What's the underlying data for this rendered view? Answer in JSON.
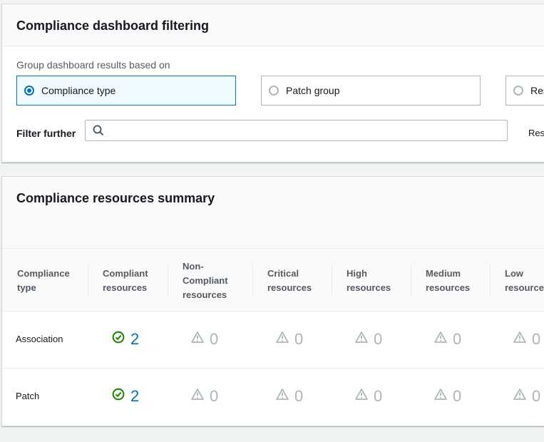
{
  "filtering": {
    "title": "Compliance dashboard filtering",
    "group_label": "Group dashboard results based on",
    "options": [
      {
        "label": "Compliance type",
        "selected": true
      },
      {
        "label": "Patch group",
        "selected": false
      },
      {
        "label": "Res",
        "selected": false
      }
    ],
    "filter_label": "Filter further",
    "search_placeholder": "",
    "reset_text": "Res"
  },
  "summary": {
    "title": "Compliance resources summary",
    "columns": [
      [
        "Compliance",
        "type"
      ],
      [
        "Compliant",
        "resources"
      ],
      [
        "Non-",
        "Compliant",
        "resources"
      ],
      [
        "Critical",
        "resources"
      ],
      [
        "High",
        "resources"
      ],
      [
        "Medium",
        "resources"
      ],
      [
        "Low",
        "resources"
      ]
    ],
    "rows": [
      {
        "name": "Association",
        "compliant": "2",
        "non_compliant": "0",
        "critical": "0",
        "high": "0",
        "medium": "0",
        "low": "0"
      },
      {
        "name": "Patch",
        "compliant": "2",
        "non_compliant": "0",
        "critical": "0",
        "high": "0",
        "medium": "0",
        "low": "0"
      }
    ]
  },
  "colors": {
    "selected_border": "#0073bb",
    "link": "#0073bb",
    "success": "#1d8102",
    "muted": "#aab7b8"
  }
}
